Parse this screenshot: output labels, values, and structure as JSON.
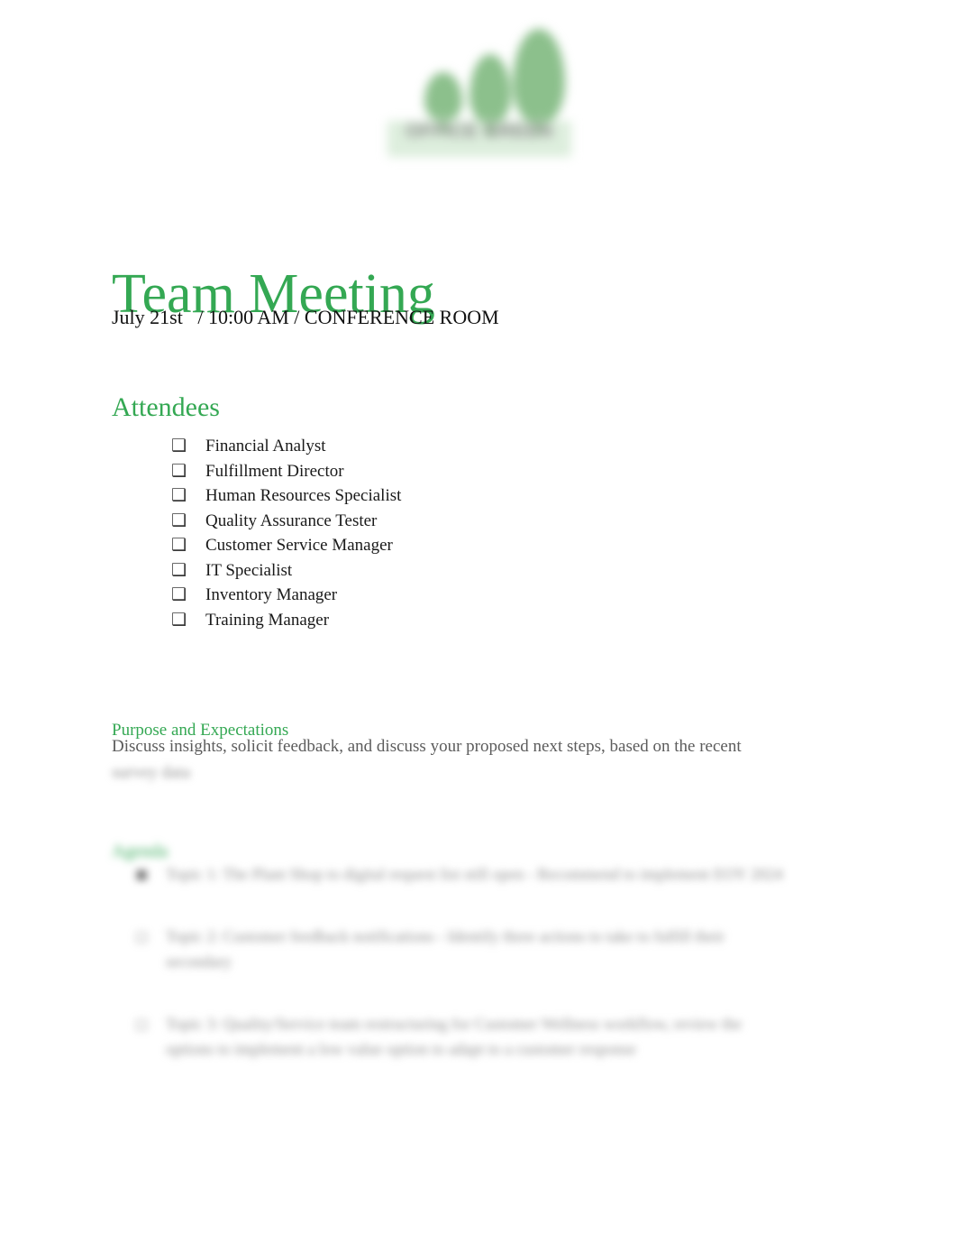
{
  "document": {
    "logo": {
      "alt": "office-green-logo",
      "wordmark": "OFFICE GREEN",
      "icon_names": [
        "tree-small-icon",
        "tree-medium-icon",
        "tree-large-icon"
      ],
      "accent_color": "#8cc08c",
      "band_color": "#ddeedd"
    },
    "title": "Team Meeting",
    "subtitle": "July 21st   / 10:00 AM / CONFERENCE ROOM",
    "accent_color": "#34a853",
    "body_color": "#5c5c5c",
    "sections": {
      "attendees": {
        "heading": "Attendees",
        "bullet_glyph": "❑",
        "items": [
          {
            "label": "Financial Analyst"
          },
          {
            "label": "Fulfillment Director"
          },
          {
            "label": "Human Resources Specialist"
          },
          {
            "label": "Quality Assurance Tester"
          },
          {
            "label": "Customer Service Manager"
          },
          {
            "label": "IT Specialist"
          },
          {
            "label": "Inventory Manager"
          },
          {
            "label": "Training Manager"
          }
        ]
      },
      "purpose": {
        "heading": "Purpose and Expectations",
        "line1": "Discuss insights, solicit feedback, and discuss your proposed next steps, based on the recent",
        "line2": "survey data"
      },
      "agenda": {
        "heading": "Agenda",
        "items": [
          {
            "bullet": "■",
            "text": "Topic 1:   The Plant Shop to digital request list still open - Recommend to implement EOY 2024"
          },
          {
            "bullet": "□",
            "text": "Topic 2:   Customer feedback notifications - Identify three actions to take to fulfill their secondary"
          },
          {
            "bullet": "□",
            "text": "Topic 3:   Quality/Service team restructuring for Customer Wellness workflow, review the options to implement a low value option to adapt to a customer response"
          }
        ]
      }
    }
  }
}
